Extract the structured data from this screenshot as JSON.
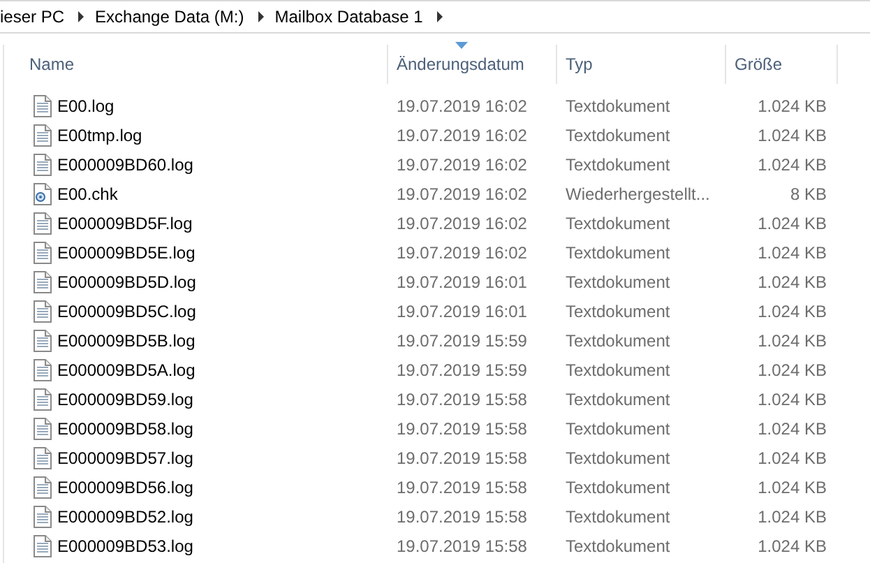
{
  "breadcrumb": [
    "ieser PC",
    "Exchange Data (M:)",
    "Mailbox Database 1"
  ],
  "columns": [
    {
      "label": "Name",
      "sorted": false
    },
    {
      "label": "Änderungsdatum",
      "sorted": true
    },
    {
      "label": "Typ",
      "sorted": false
    },
    {
      "label": "Größe",
      "sorted": false
    }
  ],
  "rows": [
    {
      "kind": "log",
      "name": "E00.log",
      "date": "19.07.2019 16:02",
      "type": "Textdokument",
      "size": "1.024 KB"
    },
    {
      "kind": "log",
      "name": "E00tmp.log",
      "date": "19.07.2019 16:02",
      "type": "Textdokument",
      "size": "1.024 KB"
    },
    {
      "kind": "log",
      "name": "E000009BD60.log",
      "date": "19.07.2019 16:02",
      "type": "Textdokument",
      "size": "1.024 KB"
    },
    {
      "kind": "chk",
      "name": "E00.chk",
      "date": "19.07.2019 16:02",
      "type": "Wiederhergestellt...",
      "size": "8 KB"
    },
    {
      "kind": "log",
      "name": "E000009BD5F.log",
      "date": "19.07.2019 16:02",
      "type": "Textdokument",
      "size": "1.024 KB"
    },
    {
      "kind": "log",
      "name": "E000009BD5E.log",
      "date": "19.07.2019 16:02",
      "type": "Textdokument",
      "size": "1.024 KB"
    },
    {
      "kind": "log",
      "name": "E000009BD5D.log",
      "date": "19.07.2019 16:01",
      "type": "Textdokument",
      "size": "1.024 KB"
    },
    {
      "kind": "log",
      "name": "E000009BD5C.log",
      "date": "19.07.2019 16:01",
      "type": "Textdokument",
      "size": "1.024 KB"
    },
    {
      "kind": "log",
      "name": "E000009BD5B.log",
      "date": "19.07.2019 15:59",
      "type": "Textdokument",
      "size": "1.024 KB"
    },
    {
      "kind": "log",
      "name": "E000009BD5A.log",
      "date": "19.07.2019 15:59",
      "type": "Textdokument",
      "size": "1.024 KB"
    },
    {
      "kind": "log",
      "name": "E000009BD59.log",
      "date": "19.07.2019 15:58",
      "type": "Textdokument",
      "size": "1.024 KB"
    },
    {
      "kind": "log",
      "name": "E000009BD58.log",
      "date": "19.07.2019 15:58",
      "type": "Textdokument",
      "size": "1.024 KB"
    },
    {
      "kind": "log",
      "name": "E000009BD57.log",
      "date": "19.07.2019 15:58",
      "type": "Textdokument",
      "size": "1.024 KB"
    },
    {
      "kind": "log",
      "name": "E000009BD56.log",
      "date": "19.07.2019 15:58",
      "type": "Textdokument",
      "size": "1.024 KB"
    },
    {
      "kind": "log",
      "name": "E000009BD52.log",
      "date": "19.07.2019 15:58",
      "type": "Textdokument",
      "size": "1.024 KB"
    },
    {
      "kind": "log",
      "name": "E000009BD53.log",
      "date": "19.07.2019 15:58",
      "type": "Textdokument",
      "size": "1.024 KB"
    }
  ]
}
